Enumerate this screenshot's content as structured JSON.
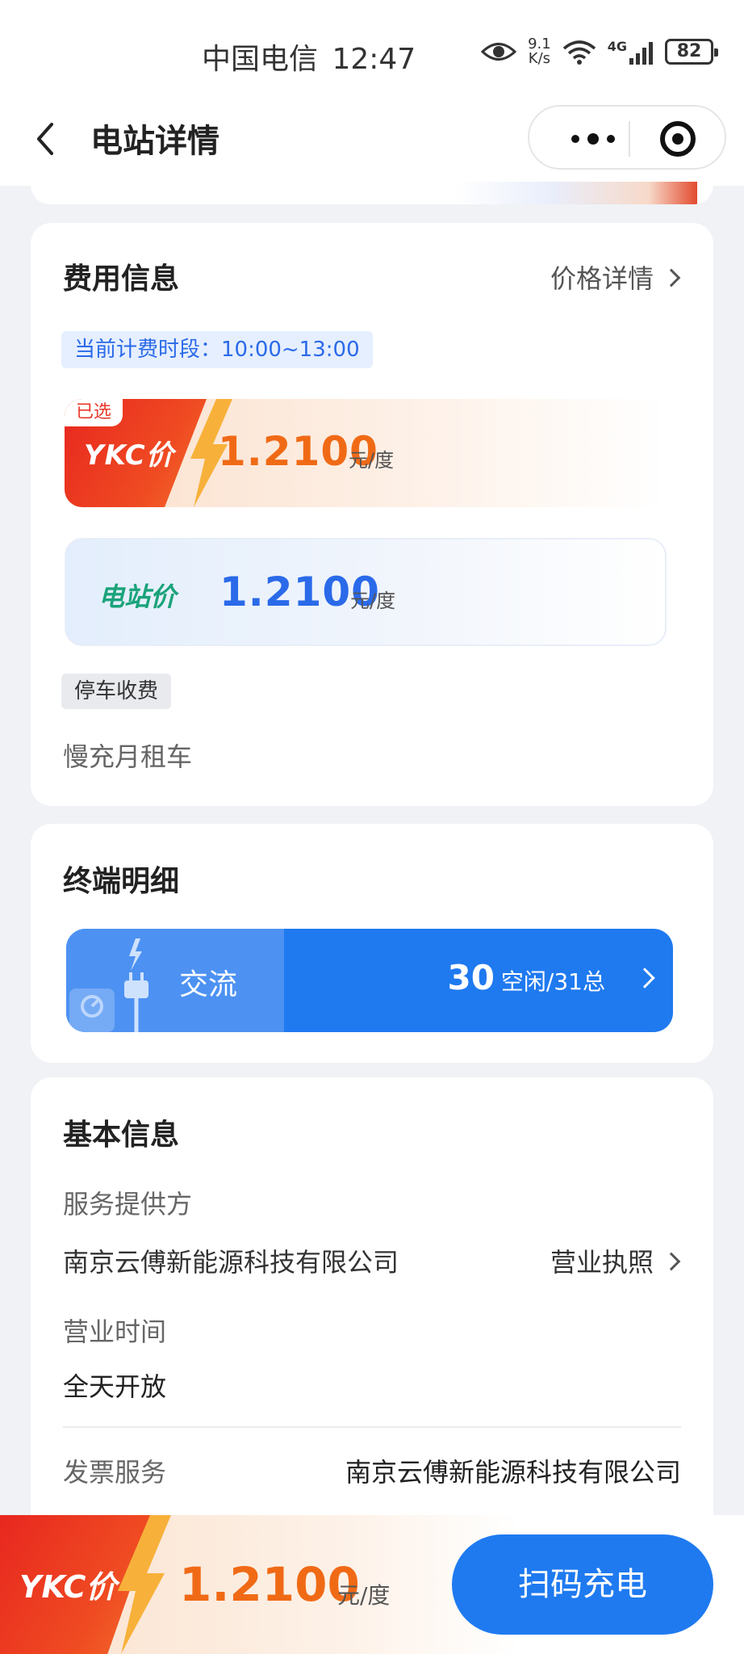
{
  "status_bar": {
    "carrier": "中国电信",
    "time": "12:47",
    "speed_value": "9.1",
    "speed_unit": "K/s",
    "network": "4G",
    "battery": "82"
  },
  "nav": {
    "title": "电站详情",
    "back_icon": "chevron-left-icon",
    "more_icon": "more-dots-icon",
    "close_icon": "target-circle-icon"
  },
  "fee_card": {
    "title": "费用信息",
    "price_detail_link": "价格详情",
    "period_tag": "当前计费时段：10:00~13:00",
    "ykc": {
      "selected_tag": "已选",
      "logo_text": "YKC价",
      "price": "1.2100",
      "unit": "元/度"
    },
    "station": {
      "label": "电站价",
      "price": "1.2100",
      "unit": "元/度"
    },
    "parking_tag": "停车收费",
    "note": "慢充月租车"
  },
  "terminal_card": {
    "title": "终端明细",
    "type": "交流",
    "free_count": "30",
    "free_total_text": "空闲/31总"
  },
  "basic_card": {
    "title": "基本信息",
    "provider_label": "服务提供方",
    "provider_value": "南京云傅新能源科技有限公司",
    "license_link": "营业执照",
    "hours_label": "营业时间",
    "hours_value": "全天开放",
    "invoice_label": "发票服务",
    "invoice_value": "南京云傅新能源科技有限公司"
  },
  "bottom_bar": {
    "logo_text": "YKC价",
    "price": "1.2100",
    "unit": "元/度",
    "scan_button": "扫码充电"
  },
  "colors": {
    "primary_blue": "#1f7af0",
    "ykc_red": "#e8271f",
    "price_orange": "#f06a16",
    "station_green": "#1aa37a"
  }
}
